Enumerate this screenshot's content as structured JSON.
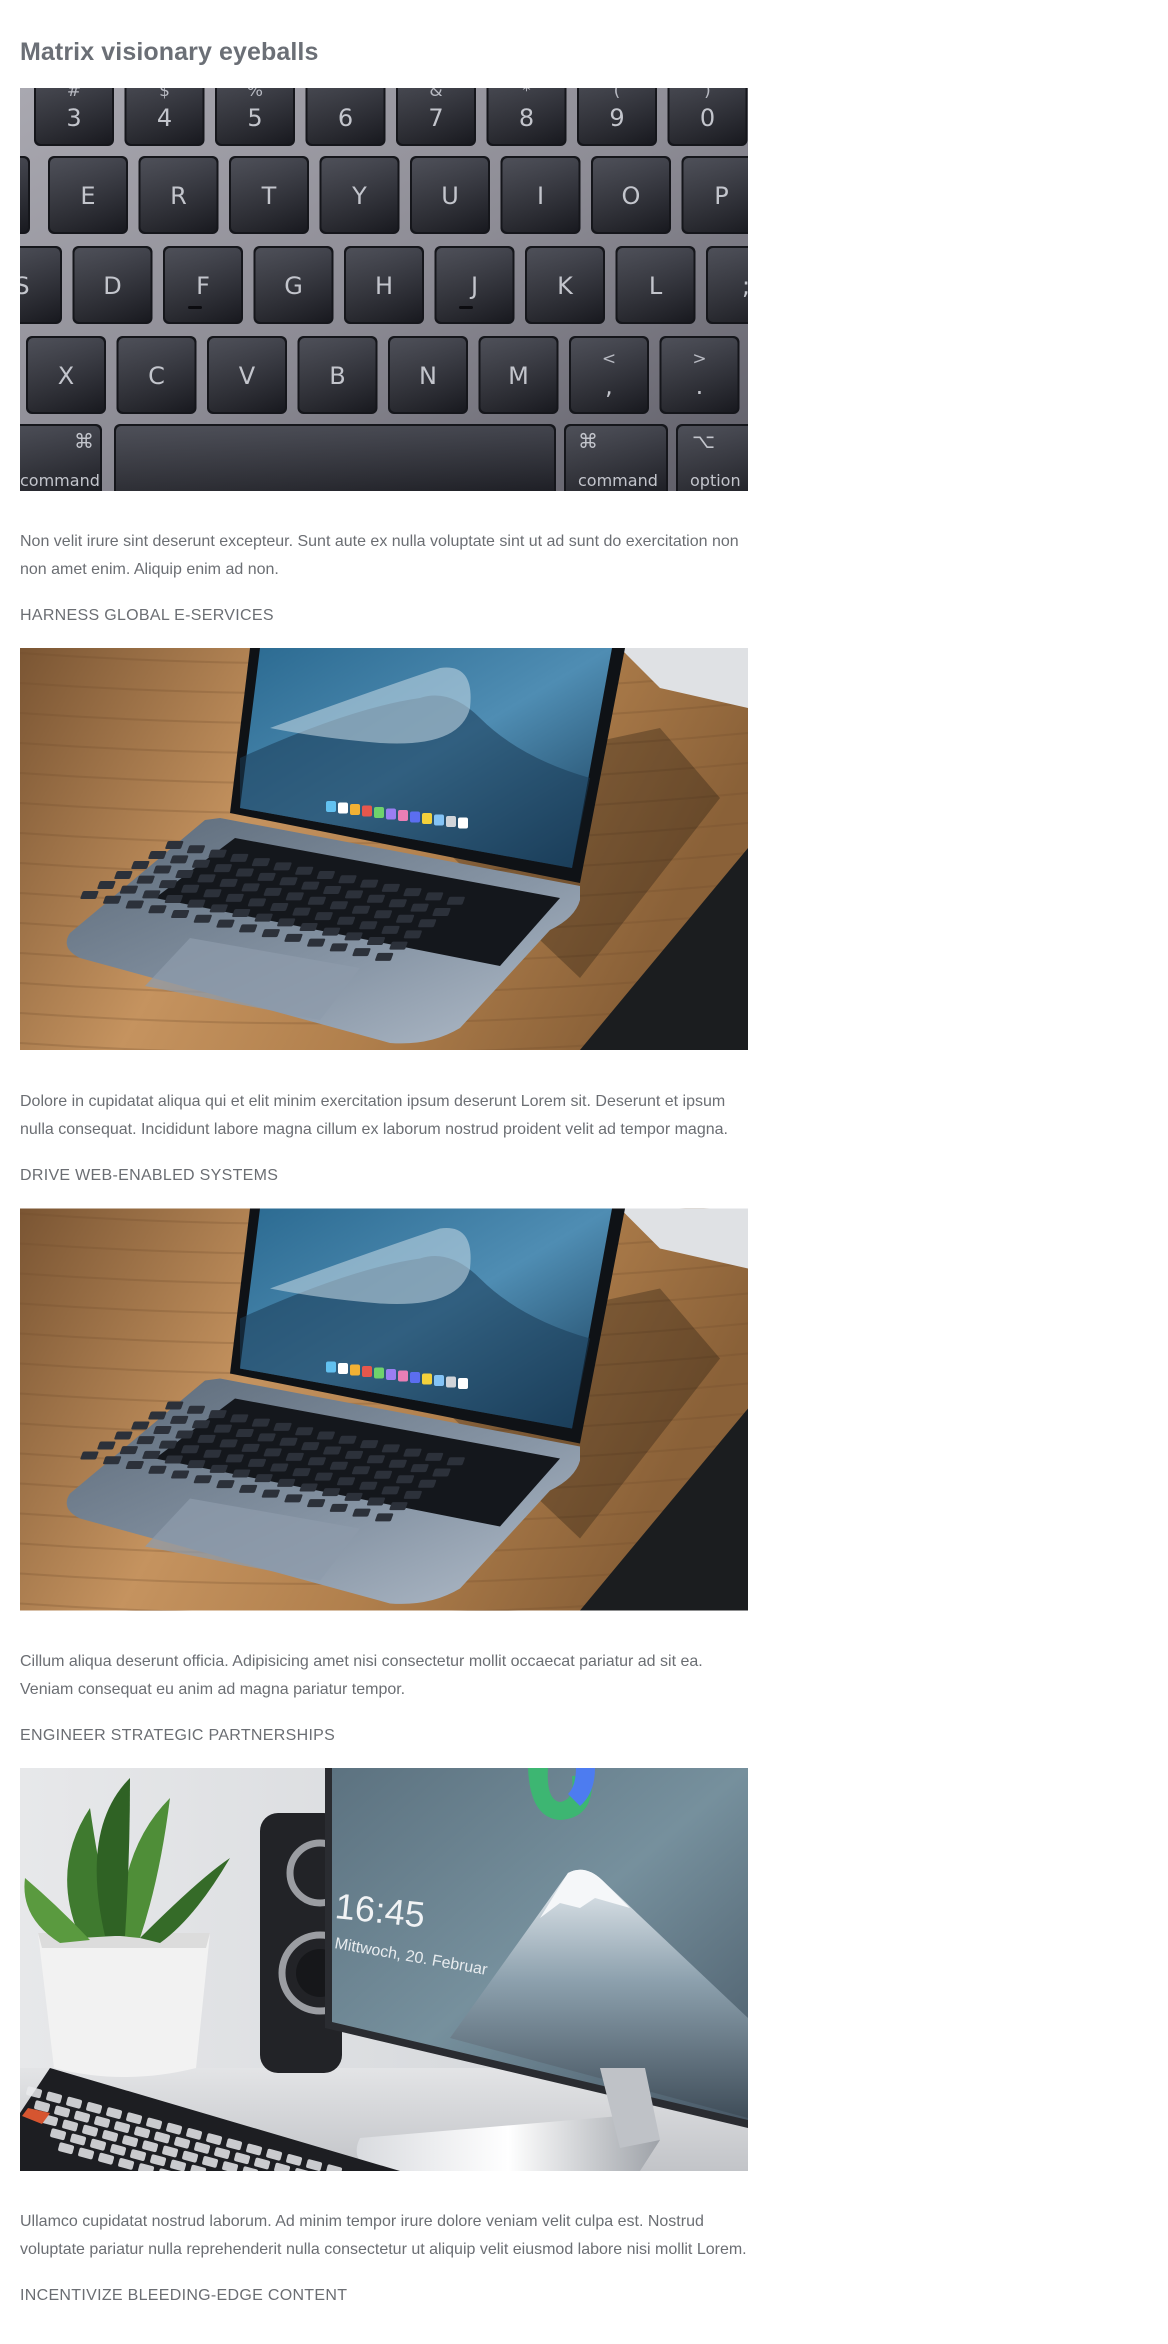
{
  "page": {
    "title": "Matrix visionary eyeballs"
  },
  "keyboard_image": {
    "number_row": [
      {
        "top": "#",
        "main": "3"
      },
      {
        "top": "$",
        "main": "4"
      },
      {
        "top": "%",
        "main": "5"
      },
      {
        "top": "^",
        "main": "6"
      },
      {
        "top": "&",
        "main": "7"
      },
      {
        "top": "*",
        "main": "8"
      },
      {
        "top": "(",
        "main": "9"
      },
      {
        "top": ")",
        "main": "0"
      }
    ],
    "qwerty_row": [
      "E",
      "R",
      "T",
      "Y",
      "U",
      "I",
      "O",
      "P"
    ],
    "home_row": [
      "S",
      "D",
      "F",
      "G",
      "H",
      "J",
      "K",
      "L",
      ";"
    ],
    "bottom_row": [
      "X",
      "C",
      "V",
      "B",
      "N",
      "M"
    ],
    "punct_keys": [
      {
        "top": "<",
        "main": ","
      },
      {
        "top": ">",
        "main": "."
      }
    ],
    "command_symbol": "⌘",
    "option_symbol": "⌥",
    "command_label": "command",
    "option_label": "option"
  },
  "lock_screen": {
    "time": "16:45",
    "date": "Mittwoch, 20. Februar"
  },
  "sections": [
    {
      "paragraph": "Non velit irure sint deserunt excepteur. Sunt aute ex nulla voluptate sint ut ad sunt do exercitation non non amet enim. Aliquip enim ad non.",
      "heading": "HARNESS GLOBAL E-SERVICES"
    },
    {
      "paragraph": "Dolore in cupidatat aliqua qui et elit minim exercitation ipsum deserunt Lorem sit. Deserunt et ipsum nulla consequat. Incididunt labore magna cillum ex laborum nostrud proident velit ad tempor magna.",
      "heading": "DRIVE WEB-ENABLED SYSTEMS"
    },
    {
      "paragraph": "Cillum aliqua deserunt officia. Adipisicing amet nisi consectetur mollit occaecat pariatur ad sit ea. Veniam consequat eu anim ad magna pariatur tempor.",
      "heading": "ENGINEER STRATEGIC PARTNERSHIPS"
    },
    {
      "paragraph": "Ullamco cupidatat nostrud laborum. Ad minim tempor irure dolore veniam velit culpa est. Nostrud voluptate pariatur nulla reprehenderit nulla consectetur ut aliquip velit eiusmod labore nisi mollit Lorem.",
      "heading": "INCENTIVIZE BLEEDING-EDGE CONTENT"
    }
  ]
}
